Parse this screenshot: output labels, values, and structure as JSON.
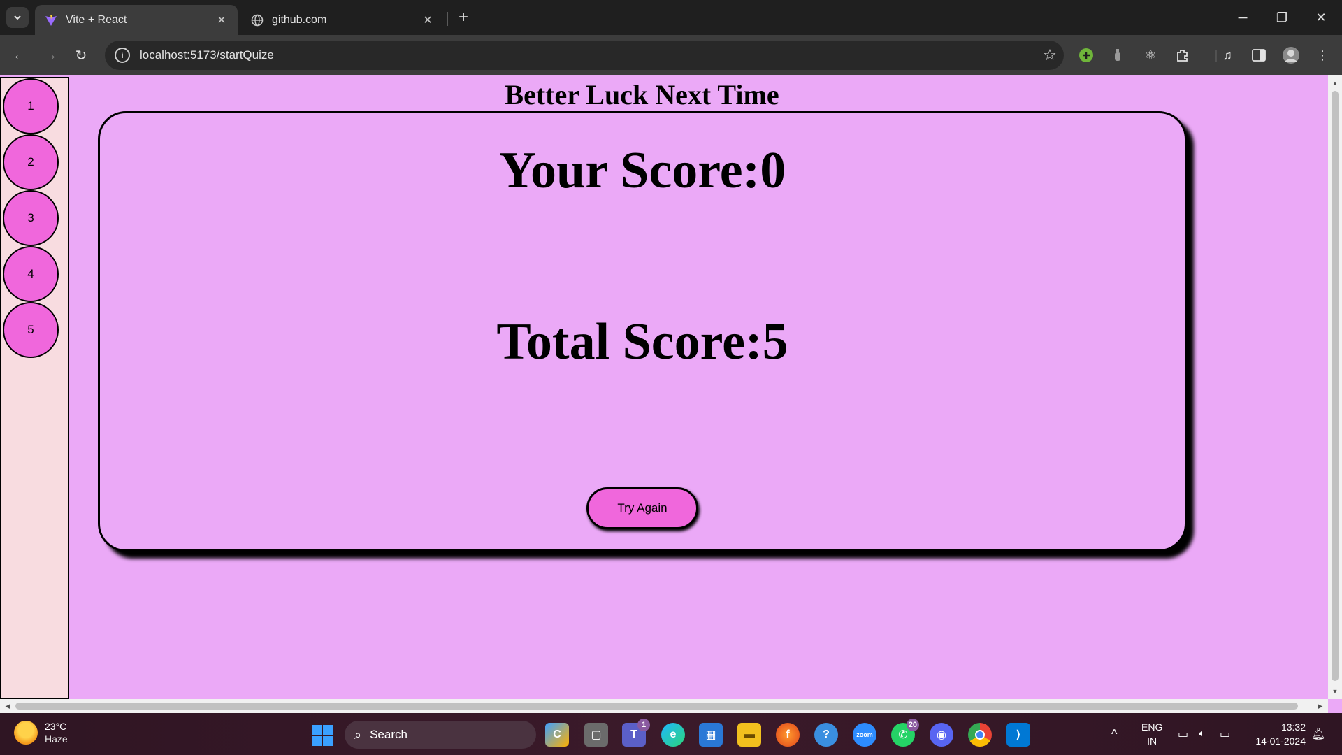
{
  "browser": {
    "tabs": [
      {
        "title": "Vite + React",
        "active": true,
        "icon": "vite-icon"
      },
      {
        "title": "github.com",
        "active": false,
        "icon": "globe-icon"
      }
    ],
    "url": "localhost:5173/startQuize"
  },
  "page": {
    "heading": "Better Luck Next Time",
    "questions": [
      "1",
      "2",
      "3",
      "4",
      "5"
    ],
    "your_score": "Your Score:0",
    "total_score": "Total Score:5",
    "try_again_label": "Try Again"
  },
  "taskbar": {
    "weather_temp": "23°C",
    "weather_desc": "Haze",
    "search_label": "Search",
    "teams_badge": "1",
    "whatsapp_badge": "20",
    "lang_top": "ENG",
    "lang_bottom": "IN",
    "time": "13:32",
    "date": "14-01-2024"
  },
  "colors": {
    "page_bg": "#eba9f7",
    "sidebar_bg": "#f8dce0",
    "accent_pink": "#f067dc"
  }
}
